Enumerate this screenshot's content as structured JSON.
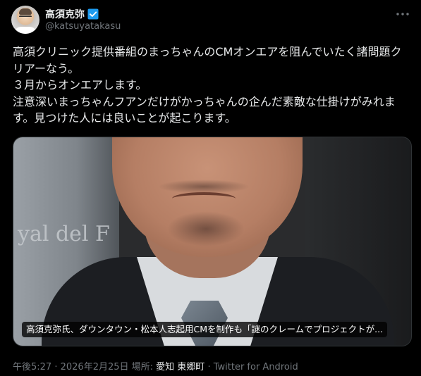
{
  "author": {
    "display_name": "高須克弥",
    "handle": "@katsuyatakasu"
  },
  "tweet": {
    "text": "高須クリニック提供番組のまっちゃんのCMオンエアを阻んでいたく諸問題クリアーなう。\n３月からオンエアします。\n注意深いまっちゃんフアンだけがかっちゃんの企んだ素敵な仕掛けがみれます。見つけた人には良いことが起こります。"
  },
  "media": {
    "wall_text": "yal del F",
    "caption": "高須克弥氏、ダウンタウン・松本人志起用CMを制作も「謎のクレームでプロジェクトが..."
  },
  "meta": {
    "time": "午後5:27",
    "sep1": " · ",
    "date": "2026年2月25日",
    "location_label": " 場所: ",
    "location": "愛知 東郷町",
    "sep2": " · ",
    "client": "Twitter for Android"
  },
  "colors": {
    "background": "#000000",
    "text": "#e7e9ea",
    "secondary": "#71767b",
    "verified": "#1d9bf0"
  },
  "icons": {
    "verified": "verified-badge-icon",
    "more": "more-options-icon"
  }
}
